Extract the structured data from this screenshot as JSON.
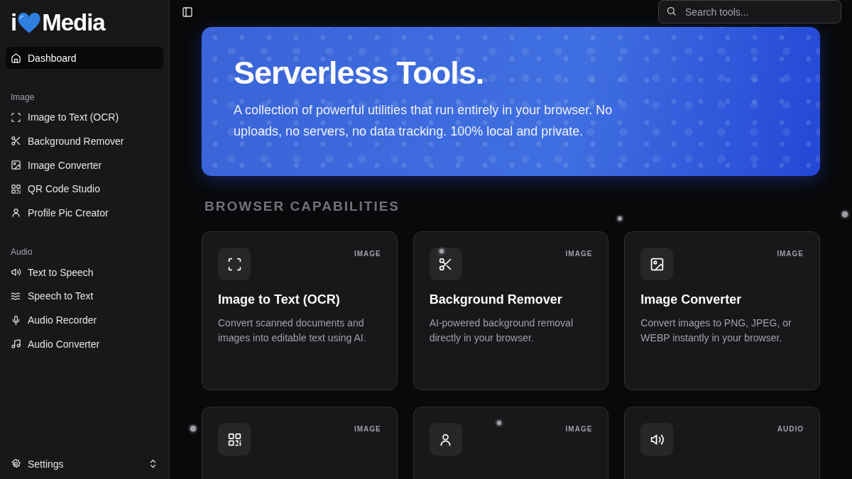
{
  "logo": {
    "prefix": "i",
    "suffix": "Media"
  },
  "sidebar": {
    "items": [
      {
        "label": "Dashboard",
        "selected": true
      }
    ],
    "groups": [
      {
        "title": "Image",
        "items": [
          {
            "label": "Image to Text (OCR)",
            "selected": false,
            "kind": "scan"
          },
          {
            "label": "Background Remover",
            "selected": false,
            "kind": "scissors"
          },
          {
            "label": "Image Converter",
            "selected": false,
            "kind": "image"
          },
          {
            "label": "QR Code Studio",
            "selected": false,
            "kind": "qr"
          },
          {
            "label": "Profile Pic Creator",
            "selected": false,
            "kind": "user"
          }
        ]
      },
      {
        "title": "Audio",
        "items": [
          {
            "label": "Text to Speech",
            "selected": false,
            "kind": "speaker"
          },
          {
            "label": "Speech to Text",
            "selected": false,
            "kind": "waves"
          },
          {
            "label": "Audio Recorder",
            "selected": false,
            "kind": "mic"
          },
          {
            "label": "Audio Converter",
            "selected": false,
            "kind": "music"
          }
        ]
      }
    ],
    "footer": {
      "label": "Settings"
    }
  },
  "search": {
    "placeholder": "Search tools..."
  },
  "hero": {
    "title": "Serverless Tools.",
    "text": "A collection of powerful utilities that run entirely in your browser. No uploads, no servers, no data tracking. 100% local and private."
  },
  "section_title": "BROWSER CAPABILITIES",
  "cards": [
    {
      "kind": "scan",
      "tag": "IMAGE",
      "title": "Image to Text (OCR)",
      "text": "Convert scanned documents and images into editable text using AI."
    },
    {
      "kind": "scissors",
      "tag": "IMAGE",
      "title": "Background Remover",
      "text": "AI-powered background removal directly in your browser."
    },
    {
      "kind": "image",
      "tag": "IMAGE",
      "title": "Image Converter",
      "text": "Convert images to PNG, JPEG, or WEBP instantly in your browser."
    },
    {
      "kind": "qr",
      "tag": "IMAGE"
    },
    {
      "kind": "user",
      "tag": "IMAGE"
    },
    {
      "kind": "speaker",
      "tag": "AUDIO"
    }
  ]
}
